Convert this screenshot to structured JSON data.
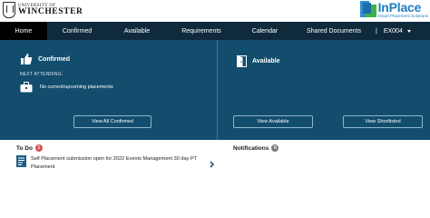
{
  "header": {
    "university_small": "UNIVERSITY OF",
    "university_name": "WINCHESTER",
    "brand_name_in": "In",
    "brand_name_place": "Place",
    "brand_tagline": "Smart Placement Solutions"
  },
  "nav": {
    "items": [
      {
        "label": "Home"
      },
      {
        "label": "Confirmed"
      },
      {
        "label": "Available"
      },
      {
        "label": "Requirements"
      },
      {
        "label": "Calendar"
      },
      {
        "label": "Shared Documents"
      }
    ],
    "separator": "|",
    "user_label": "EX004"
  },
  "confirmed_panel": {
    "title": "Confirmed",
    "next_attending_label": "NEXT ATTENDING:",
    "empty_text": "No current/upcoming placements",
    "button_label": "View All Confirmed"
  },
  "available_panel": {
    "title": "Available",
    "button_available": "View Available",
    "button_shortlisted": "View Shortlisted"
  },
  "todo": {
    "title": "To Do",
    "count": "1",
    "items": [
      {
        "text": "Self Placement submission open for 2022 Events Management 30 day PT Placement"
      }
    ]
  },
  "notifications": {
    "title": "Notifications",
    "count": "0"
  },
  "colors": {
    "nav_bg": "#0f2a3b",
    "hero_bg": "#124d6d",
    "brand_blue": "#1f7ec1",
    "badge_red": "#d9534f"
  },
  "icons": {
    "confirmed": "thumbs-up-icon",
    "available": "door-icon",
    "placements": "briefcase-icon",
    "todo_item": "document-icon",
    "todo_chevron": "chevron-right-icon"
  }
}
